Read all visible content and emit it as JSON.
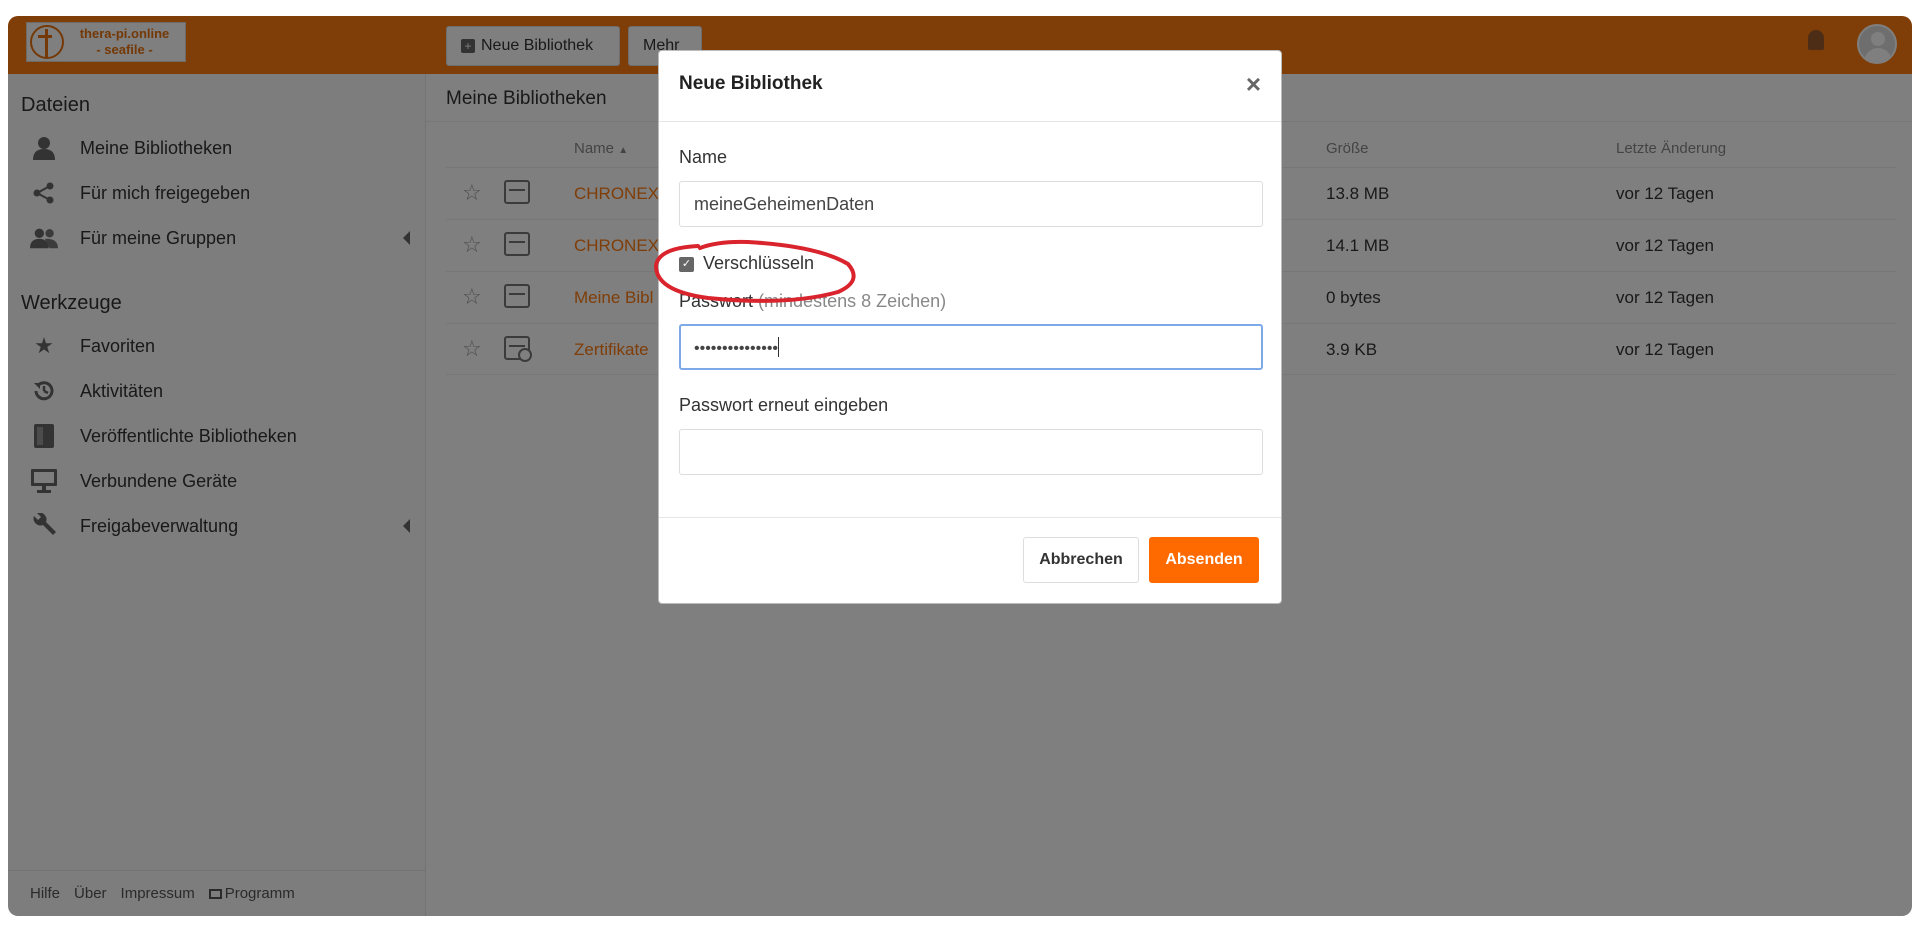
{
  "header": {
    "logo_line1": "thera-pi.online",
    "logo_line2": "- seafile -",
    "new_library_button": "Neue Bibliothek",
    "more_button": "Mehr"
  },
  "sidebar": {
    "files_heading": "Dateien",
    "files_items": [
      {
        "label": "Meine Bibliotheken",
        "icon": "person-icon"
      },
      {
        "label": "Für mich freigegeben",
        "icon": "share-icon"
      },
      {
        "label": "Für meine Gruppen",
        "icon": "group-icon"
      }
    ],
    "tools_heading": "Werkzeuge",
    "tools_items": [
      {
        "label": "Favoriten",
        "icon": "star-icon"
      },
      {
        "label": "Aktivitäten",
        "icon": "history-icon"
      },
      {
        "label": "Veröffentlichte Bibliotheken",
        "icon": "book-icon"
      },
      {
        "label": "Verbundene Geräte",
        "icon": "monitor-icon"
      },
      {
        "label": "Freigabeverwaltung",
        "icon": "wrench-icon"
      }
    ],
    "footer": {
      "help": "Hilfe",
      "about": "Über",
      "imprint": "Impressum",
      "program": "Programm"
    }
  },
  "main": {
    "path": "Meine Bibliotheken",
    "columns": {
      "name": "Name",
      "size": "Größe",
      "modified": "Letzte Änderung"
    },
    "rows": [
      {
        "name": "CHRONEX",
        "size": "13.8 MB",
        "modified": "vor 12 Tagen"
      },
      {
        "name": "CHRONEX",
        "size": "14.1 MB",
        "modified": "vor 12 Tagen"
      },
      {
        "name": "Meine Bibl",
        "size": "0 bytes",
        "modified": "vor 12 Tagen"
      },
      {
        "name": "Zertifikate",
        "size": "3.9 KB",
        "modified": "vor 12 Tagen"
      }
    ]
  },
  "modal": {
    "title": "Neue Bibliothek",
    "name_label": "Name",
    "name_value": "meineGeheimenDaten",
    "encrypt_label": "Verschlüsseln",
    "encrypt_checked": true,
    "password_label": "Passwort",
    "password_hint": "(mindestens 8 Zeichen)",
    "password_value": "•••••••••••••••",
    "password_repeat_label": "Passwort erneut eingeben",
    "password_repeat_value": "",
    "cancel_button": "Abbrechen",
    "submit_button": "Absenden"
  },
  "colors": {
    "brand": "#ff7b10",
    "submit": "#ff6a00",
    "annotation": "#d9232d"
  }
}
